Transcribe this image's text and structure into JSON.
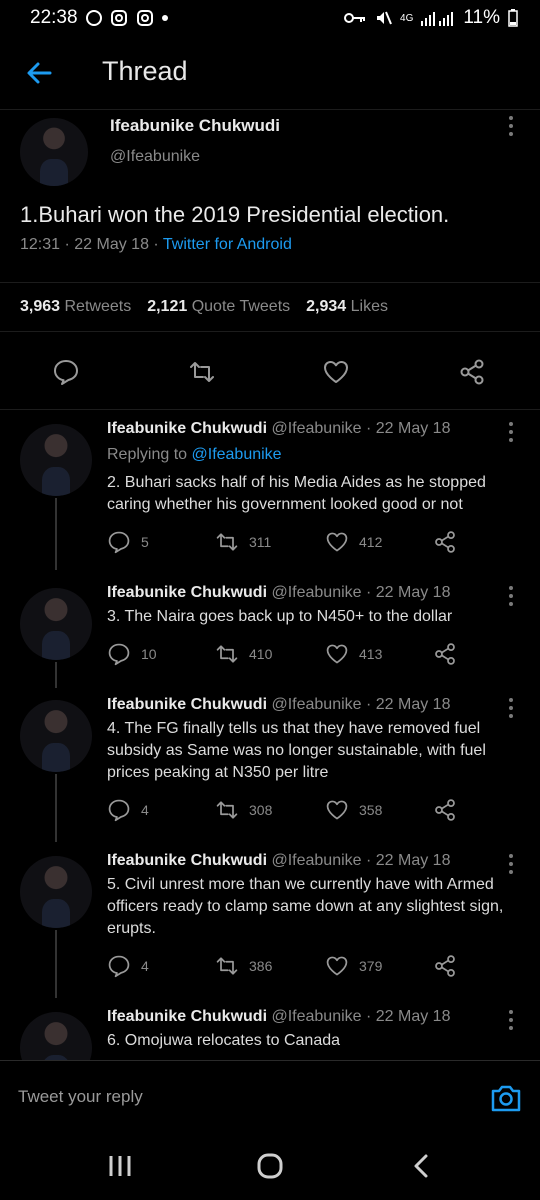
{
  "status": {
    "time": "22:38",
    "network": "4G",
    "battery": "11%"
  },
  "header": {
    "title": "Thread"
  },
  "main_tweet": {
    "name": "Ifeabunike Chukwudi",
    "handle": "@Ifeabunike",
    "text": "1.Buhari won the 2019 Presidential election.",
    "time": "12:31 · 22 May 18 · ",
    "source": "Twitter for Android",
    "retweets": "3,963",
    "retweets_label": "Retweets",
    "quotes": "2,121",
    "quotes_label": "Quote Tweets",
    "likes": "2,934",
    "likes_label": "Likes"
  },
  "replies": [
    {
      "name": "Ifeabunike Chukwudi",
      "handle_date": "@Ifeabunike · 22 May 18",
      "replying_prefix": "Replying to ",
      "replying_to": "@Ifeabunike",
      "text": "2. Buhari sacks half of his Media Aides as he stopped caring whether his government looked good or not",
      "replies": "5",
      "retweets": "311",
      "likes": "412"
    },
    {
      "name": "Ifeabunike Chukwudi",
      "handle_date": "@Ifeabunike · 22 May 18",
      "text": "3. The Naira goes back up to N450+ to the dollar",
      "replies": "10",
      "retweets": "410",
      "likes": "413"
    },
    {
      "name": "Ifeabunike Chukwudi",
      "handle_date": "@Ifeabunike · 22 May 18",
      "text": "4. The FG finally tells us that they have removed fuel subsidy as Same was no longer sustainable, with fuel prices peaking at N350 per litre",
      "replies": "4",
      "retweets": "308",
      "likes": "358"
    },
    {
      "name": "Ifeabunike Chukwudi",
      "handle_date": "@Ifeabunike · 22 May 18",
      "text": "5. Civil unrest more than we currently have with Armed officers ready to clamp same down at any slightest sign, erupts.",
      "replies": "4",
      "retweets": "386",
      "likes": "379"
    },
    {
      "name": "Ifeabunike Chukwudi",
      "handle_date": "@Ifeabunike · 22 May 18",
      "text": "6. Omojuwa relocates to Canada"
    }
  ],
  "reply_bar": {
    "placeholder": "Tweet your reply"
  },
  "colors": {
    "accent": "#1d9bf0",
    "background": "#000000",
    "muted": "#8a8a8a"
  }
}
